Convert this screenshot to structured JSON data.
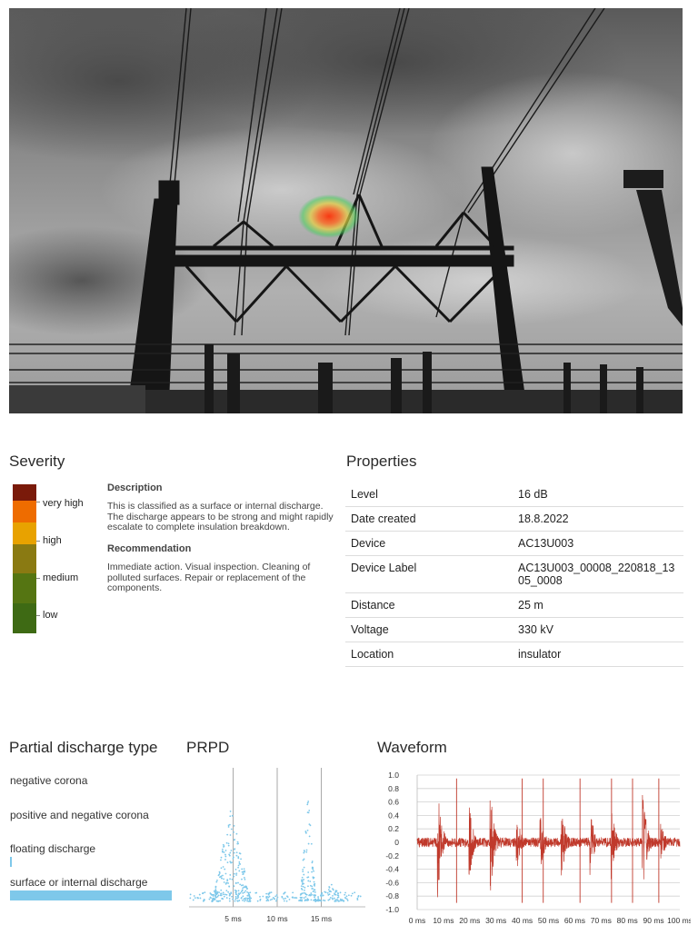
{
  "photo": {
    "subject": "substation-structure-photo-with-acoustic-heatmap"
  },
  "severity": {
    "title": "Severity",
    "levels": [
      "very high",
      "high",
      "medium",
      "low"
    ],
    "colors": [
      "#7a1a0a",
      "#ee6c00",
      "#e8a200",
      "#8a7a12",
      "#557512",
      "#3e6a14"
    ],
    "description_heading": "Description",
    "description_text": "This is classified as a surface or internal discharge. The discharge appears to be strong and might rapidly escalate to complete insulation breakdown.",
    "recommendation_heading": "Recommendation",
    "recommendation_text": "Immediate action. Visual inspection. Cleaning of polluted surfaces. Repair or replacement of the components."
  },
  "properties": {
    "title": "Properties",
    "rows": [
      {
        "key": "Level",
        "value": "16 dB"
      },
      {
        "key": "Date created",
        "value": "18.8.2022"
      },
      {
        "key": "Device",
        "value": "AC13U003"
      },
      {
        "key": "Device Label",
        "value": "AC13U003_00008_220818_1305_0008"
      },
      {
        "key": "Distance",
        "value": "25 m"
      },
      {
        "key": "Voltage",
        "value": "330 kV"
      },
      {
        "key": "Location",
        "value": "insulator"
      }
    ]
  },
  "pd_type": {
    "title": "Partial discharge type",
    "items": [
      {
        "label": "negative corona",
        "value": 0
      },
      {
        "label": "positive and negative corona",
        "value": 0
      },
      {
        "label": "floating discharge",
        "value": 0.01
      },
      {
        "label": "surface or internal discharge",
        "value": 1.0
      }
    ],
    "bar_color": "#7ec8ea"
  },
  "chart_data": [
    {
      "type": "scatter",
      "title": "PRPD",
      "x_ticks": [
        "5 ms",
        "10 ms",
        "15 ms"
      ],
      "xlim": [
        0,
        20
      ],
      "vlines": [
        5,
        10,
        15
      ],
      "color": "#7ec8ea"
    },
    {
      "type": "line",
      "title": "Waveform",
      "x_ticks": [
        "0 ms",
        "10 ms",
        "20 ms",
        "30 ms",
        "40 ms",
        "50 ms",
        "60 ms",
        "70 ms",
        "80 ms",
        "90 ms",
        "100 ms"
      ],
      "y_ticks": [
        "1.0",
        "0.8",
        "0.6",
        "0.4",
        "0.2",
        "0",
        "-0.2",
        "-0.4",
        "-0.6",
        "-0.8",
        "-1.0"
      ],
      "xlim": [
        0,
        100
      ],
      "ylim": [
        -1.0,
        1.0
      ],
      "color": "#c0392b",
      "burst_times_ms": [
        8,
        20,
        28,
        38,
        47,
        55,
        66,
        74,
        86,
        93
      ],
      "burst_amplitudes": [
        0.82,
        0.55,
        0.76,
        0.45,
        0.42,
        0.55,
        0.5,
        0.55,
        0.82,
        0.3
      ],
      "spike_times_ms": [
        15,
        40,
        48,
        62,
        74,
        82,
        92
      ]
    }
  ]
}
